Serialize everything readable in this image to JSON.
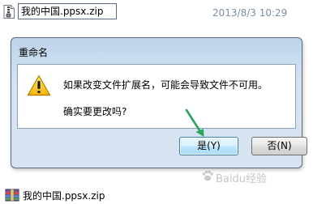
{
  "file_row": {
    "rename_value": "我的中国.ppsx.zip",
    "modified_date": "2013/8/3 10:29"
  },
  "dialog": {
    "title": "重命名",
    "message": "如果改变文件扩展名，可能会导致文件不可用。",
    "question": "确实要更改吗?",
    "yes_label": "是(Y)",
    "no_label": "否(N)"
  },
  "bottom_row": {
    "file_name": "我的中国.ppsx.zip"
  },
  "watermark": "Baidu经验",
  "icons": {
    "file": "zip-file-icon",
    "warning": "warning-icon",
    "annotation": "green-arrow-icon"
  },
  "colors": {
    "dialog_bg": "#d6e4f2",
    "arrow": "#2aa55a",
    "date_text": "#7a8fa6"
  }
}
